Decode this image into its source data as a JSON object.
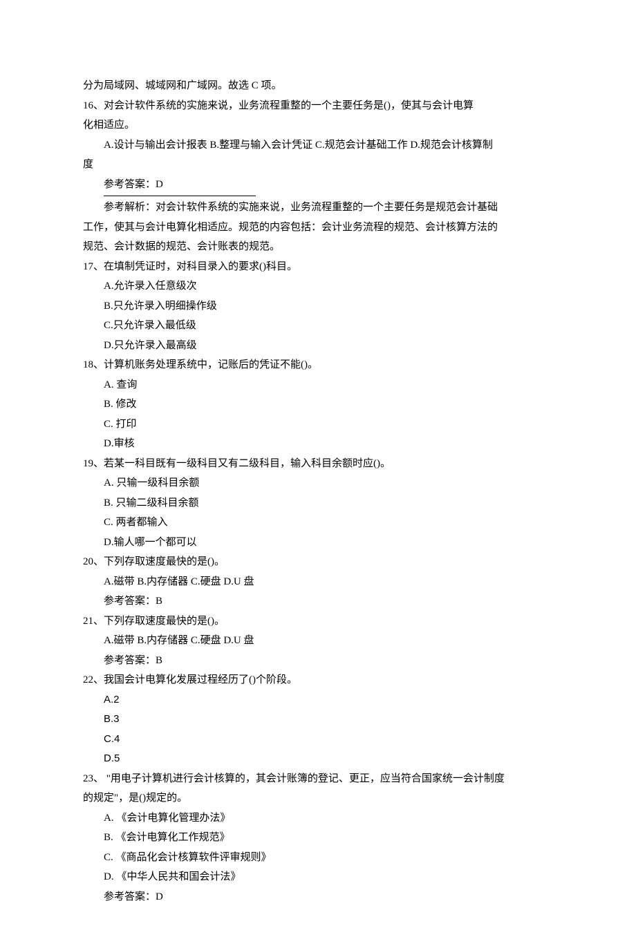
{
  "intro_tail": "分为局域网、城域网和广域网。故选 C 项。",
  "q16": {
    "stem1": "16、对会计软件系统的实施来说，业务流程重整的一个主要任务是()，使其与会计电算",
    "stem2": "化相适应。",
    "options": "A.设计与输出会计报表 B.整理与输入会计凭证 C.规范会计基础工作 D.规范会计核算制",
    "options_tail": "度",
    "answer": "参考答案：D",
    "explain1": "参考解析：对会计软件系统的实施来说，业务流程重整的一个主要任务是规范会计基础",
    "explain2": "工作，使其与会计电算化相适应。规范的内容包括：会计业务流程的规范、会计核算方法的",
    "explain3": "规范、会计数据的规范、会计账表的规范。"
  },
  "q17": {
    "stem": "17、在填制凭证时，对科目录入的要求()科目。",
    "a": "A.允许录入任意级次",
    "b": "B.只允许录入明细操作级",
    "c": "C.只允许录入最低级",
    "d": "D.只允许录入最高级"
  },
  "q18": {
    "stem": "18、计算机账务处理系统中，记账后的凭证不能()。",
    "a": "A.  查询",
    "b": "B.  修改",
    "c": "C.  打印",
    "d": "D.审核"
  },
  "q19": {
    "stem": "19、若某一科目既有一级科目又有二级科目，输入科目余额时应()。",
    "a": "A.  只输一级科目余额",
    "b": "B.  只输二级科目余额",
    "c": "C.  两者都输入",
    "d": "D.输人哪一个都可以"
  },
  "q20": {
    "stem": "20、下列存取速度最快的是()。",
    "options": "A.磁带 B.内存储器 C.硬盘 D.U 盘",
    "answer": "参考答案：B"
  },
  "q21": {
    "stem": "21、下列存取速度最快的是()。",
    "options": "A.磁带 B.内存储器 C.硬盘 D.U 盘",
    "answer": "参考答案：B"
  },
  "q22": {
    "stem": "22、我国会计电算化发展过程经历了()个阶段。",
    "a": "A.2",
    "b": "B.3",
    "c": "C.4",
    "d": "D.5"
  },
  "q23": {
    "stem1": "23、 \"用电子计算机进行会计核算的，其会计账簿的登记、更正，应当符合国家统一会计制度",
    "stem2": "的规定\"，是()规定的。",
    "a": "A.  《会计电算化管理办法》",
    "b": "B.  《会计电算化工作规范》",
    "c": "C.  《商品化会计核算软件评审规则》",
    "d": "D.  《中华人民共和国会计法》",
    "answer": "参考答案：D"
  }
}
